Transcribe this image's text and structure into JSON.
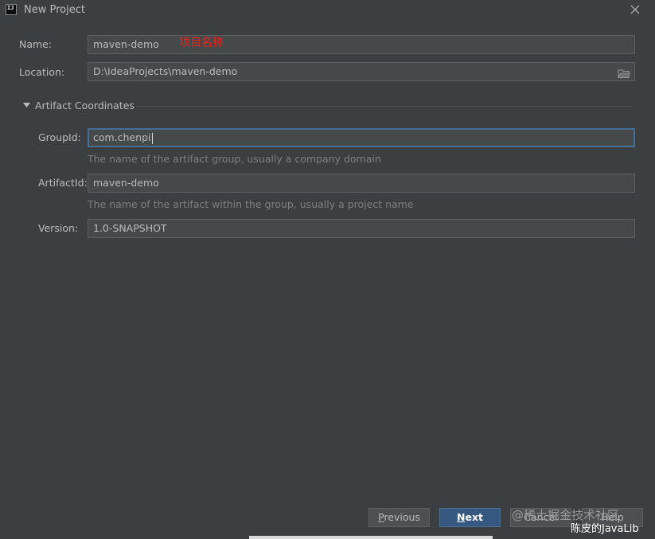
{
  "window": {
    "title": "New Project",
    "app_icon_text": "IJ"
  },
  "form": {
    "name": {
      "label": "Name:",
      "value": "maven-demo",
      "annotation": "项目名称"
    },
    "location": {
      "label": "Location:",
      "value": "D:\\IdeaProjects\\maven-demo"
    },
    "artifact_section": {
      "label": "Artifact Coordinates",
      "expanded": true
    },
    "group_id": {
      "label": "GroupId:",
      "value": "com.chenpi",
      "hint": "The name of the artifact group, usually a company domain"
    },
    "artifact_id": {
      "label": "ArtifactId:",
      "value": "maven-demo",
      "hint": "The name of the artifact within the group, usually a project name"
    },
    "version": {
      "label": "Version:",
      "value": "1.0-SNAPSHOT"
    }
  },
  "buttons": {
    "previous": {
      "mnemonic": "P",
      "rest": "revious"
    },
    "next": {
      "mnemonic": "N",
      "rest": "ext"
    },
    "cancel": "Cancel",
    "help": "Help"
  },
  "watermark": {
    "line1": "@稀土掘金技术社区",
    "line2": "陈皮的JavaLib"
  },
  "colors": {
    "background": "#3c3f41",
    "field": "#45494a",
    "focus_border": "#466d94",
    "primary_button": "#365880",
    "annotation": "#e8241d"
  },
  "icons": {
    "close": "close-icon",
    "folder": "folder-icon",
    "section_toggle": "triangle-down-icon"
  }
}
